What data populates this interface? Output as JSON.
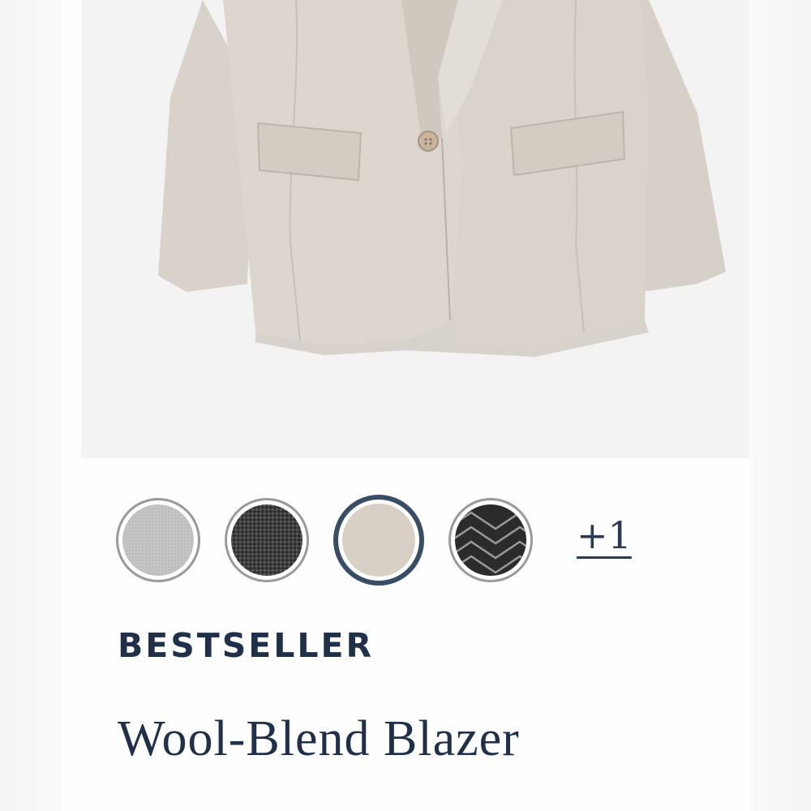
{
  "product": {
    "image_alt": "Wool-Blend Blazer",
    "badge": "BESTSELLER",
    "title": "Wool-Blend Blazer"
  },
  "swatches": [
    {
      "name": "light-grey",
      "color": "#c6c6c6",
      "selected": false
    },
    {
      "name": "dark-grey-houndstooth",
      "color": "#4a4a4a",
      "selected": false
    },
    {
      "name": "oatmeal",
      "color": "#d6cfc6",
      "selected": true
    },
    {
      "name": "black-herringbone",
      "color": "#2e2e2e",
      "selected": false
    }
  ],
  "more_colors_label": "+1",
  "colors": {
    "accent": "#3a4d66",
    "text": "#1f3048",
    "blazer": "#d9d3cb"
  }
}
